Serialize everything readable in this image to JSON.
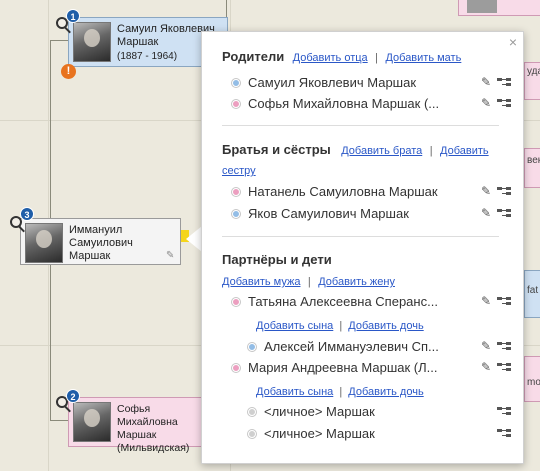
{
  "tree": {
    "cards": {
      "father": {
        "name": "Самуил Яковлевич Маршак",
        "dates": "(1887 - 1964)",
        "badge": "1"
      },
      "focus": {
        "name": "Иммануил Самуилович Маршак",
        "badge": "3"
      },
      "mother": {
        "name": "Софья Михайловна Маршак (Мильвидская)",
        "badge": "2"
      }
    },
    "peek_right": [
      "уда",
      "век",
      "fat",
      "mo"
    ]
  },
  "popup": {
    "close": "×",
    "parents": {
      "title": "Родители",
      "add_father": "Добавить отца",
      "add_mother": "Добавить мать",
      "separator": "|",
      "members": [
        {
          "name": "Самуил Яковлевич Маршак",
          "gender": "m"
        },
        {
          "name": "Софья Михайловна Маршак (...",
          "gender": "f"
        }
      ]
    },
    "siblings": {
      "title": "Братья и сёстры",
      "add_brother": "Добавить брата",
      "add_sister_1": "Добавить",
      "add_sister_2": "сестру",
      "separator": "|",
      "members": [
        {
          "name": "Натанель Самуиловна Маршак",
          "gender": "f"
        },
        {
          "name": "Яков Самуилович Маршак",
          "gender": "m"
        }
      ]
    },
    "partners": {
      "title": "Партнёры и дети",
      "add_husband": "Добавить мужа",
      "add_wife": "Добавить жену",
      "separator": "|",
      "partner1": "Татьяна Алексеевна Сперанс...",
      "partner1_add_son": "Добавить сына",
      "partner1_add_daughter": "Добавить дочь",
      "child1": "Алексей Иммануэлевич Сп...",
      "partner2": "Мария Андреевна Маршак (Л...",
      "partner2_add_son": "Добавить сына",
      "partner2_add_daughter": "Добавить дочь",
      "child2": "<личное> Маршак",
      "child3": "<личное> Маршак"
    }
  },
  "icons": {
    "pencil": "✎",
    "edit_small": "✎",
    "warning": "!"
  },
  "colors": {
    "link": "#2a57c7",
    "male": "#93bde6",
    "female": "#ec9fc0",
    "badge": "#1f5ea8",
    "warning": "#e8731e"
  }
}
